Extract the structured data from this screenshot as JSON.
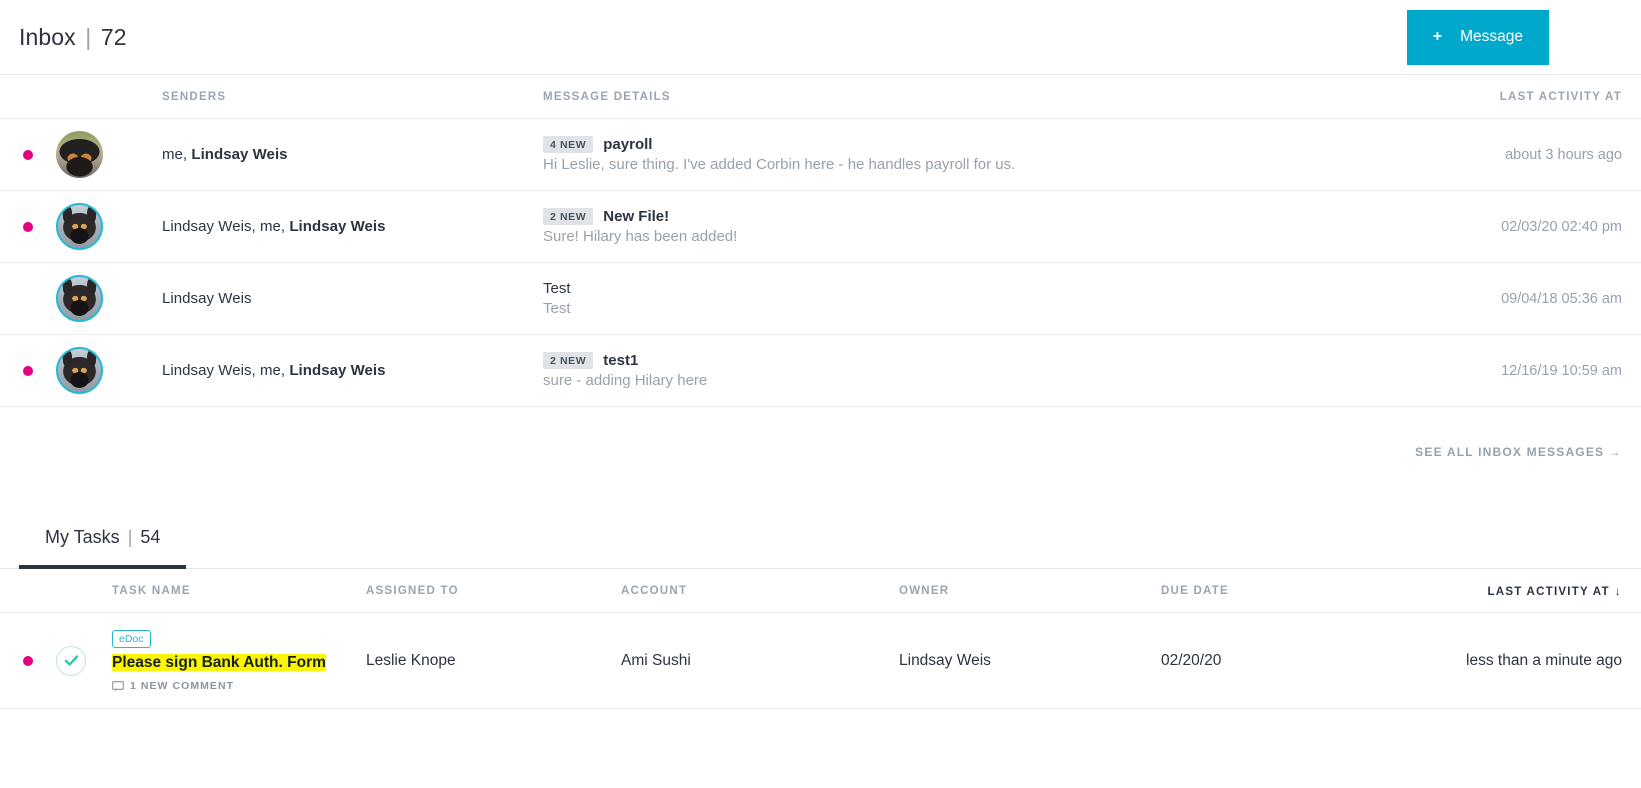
{
  "header": {
    "title": "Inbox",
    "separator": "|",
    "count": "72",
    "new_message_button": {
      "plus": "+",
      "label": "Message"
    }
  },
  "inbox": {
    "columns": {
      "senders": "SENDERS",
      "message_details": "MESSAGE DETAILS",
      "last_activity_at": "LAST ACTIVITY AT"
    },
    "see_all_label": "SEE ALL INBOX MESSAGES →",
    "rows": [
      {
        "unread": true,
        "avatar": "dog-photo-outdoor",
        "senders_plain": "me, ",
        "senders_bold": "Lindsay Weis",
        "badge": "4 NEW",
        "subject": "payroll",
        "subject_bold": true,
        "preview": "Hi Leslie, sure thing. I've added Corbin here - he handles payroll for us.",
        "last_activity": "about 3 hours ago"
      },
      {
        "unread": true,
        "avatar": "dog-photo-closeup",
        "senders_plain": "Lindsay Weis, me, ",
        "senders_bold": "Lindsay Weis",
        "badge": "2 NEW",
        "subject": "New File!",
        "subject_bold": true,
        "preview": "Sure! Hilary has been added!",
        "last_activity": "02/03/20 02:40 pm"
      },
      {
        "unread": false,
        "avatar": "dog-photo-closeup",
        "senders_plain": "Lindsay Weis",
        "senders_bold": "",
        "badge": "",
        "subject": "Test",
        "subject_bold": false,
        "preview": "Test",
        "last_activity": "09/04/18 05:36 am"
      },
      {
        "unread": true,
        "avatar": "dog-photo-closeup",
        "senders_plain": "Lindsay Weis, me, ",
        "senders_bold": "Lindsay Weis",
        "badge": "2 NEW",
        "subject": "test1",
        "subject_bold": true,
        "preview": "sure - adding Hilary here",
        "last_activity": "12/16/19 10:59 am"
      }
    ]
  },
  "tasks": {
    "tab": {
      "label": "My Tasks",
      "separator": "|",
      "count": "54"
    },
    "columns": {
      "task_name": "TASK NAME",
      "assigned_to": "ASSIGNED TO",
      "account": "ACCOUNT",
      "owner": "OWNER",
      "due_date": "DUE DATE",
      "last_activity_at": "LAST ACTIVITY AT",
      "sort_arrow": "↓"
    },
    "rows": [
      {
        "unread": true,
        "tag": "eDoc",
        "name": "Please sign Bank Auth. Form",
        "comment_note": "1 NEW COMMENT",
        "assigned_to": "Leslie Knope",
        "account": "Ami Sushi",
        "owner": "Lindsay Weis",
        "due_date": "02/20/20",
        "last_activity": "less than a minute ago"
      }
    ]
  },
  "colors": {
    "accent_teal": "#00a9cc",
    "unread_dot_pink": "#e6007e",
    "highlight_yellow": "#fcf500",
    "check_green": "#2ec4a6"
  }
}
